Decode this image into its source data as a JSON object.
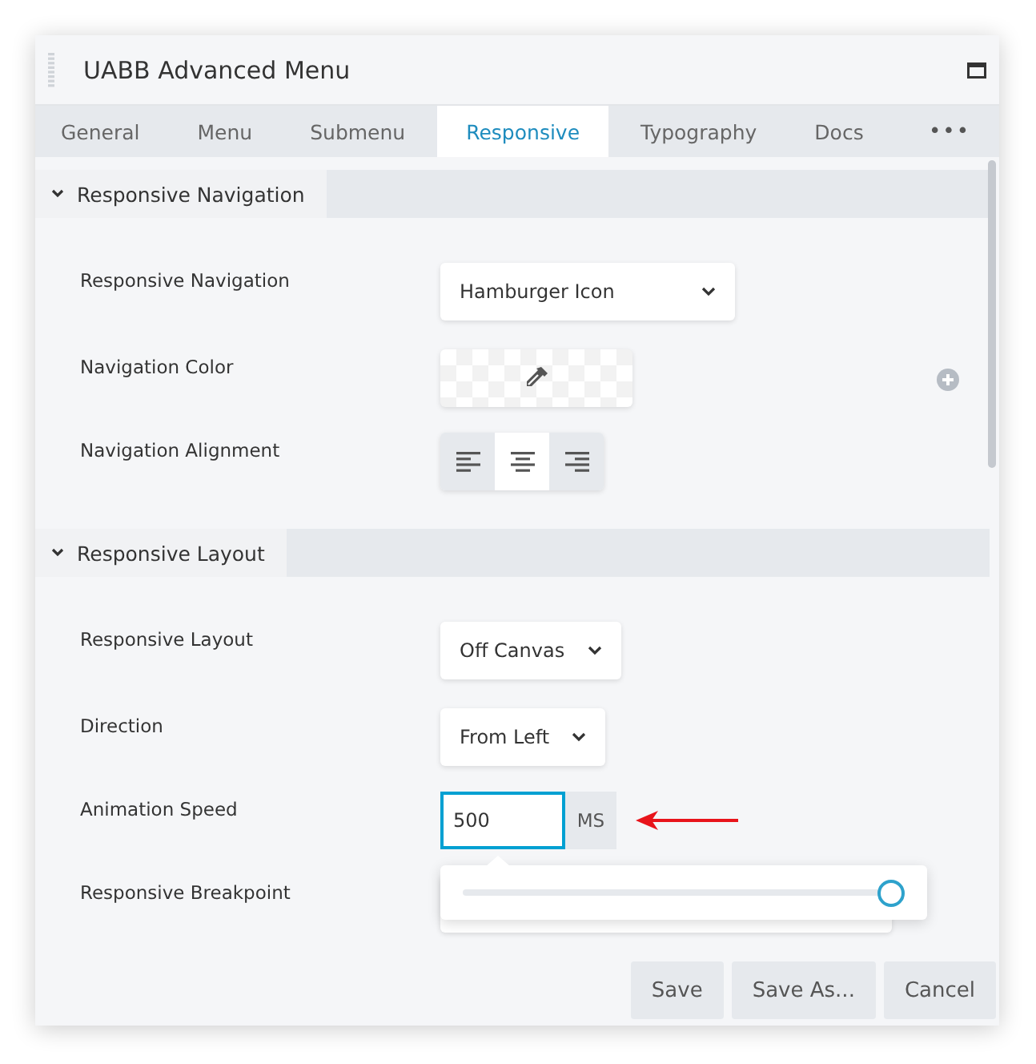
{
  "window": {
    "title": "UABB Advanced Menu"
  },
  "tabs": [
    {
      "label": "General",
      "selected": false
    },
    {
      "label": "Menu",
      "selected": false
    },
    {
      "label": "Submenu",
      "selected": false
    },
    {
      "label": "Responsive",
      "selected": true
    },
    {
      "label": "Typography",
      "selected": false
    },
    {
      "label": "Docs",
      "selected": false
    }
  ],
  "more_tabs": "•••",
  "sections": [
    {
      "title": "Responsive Navigation",
      "expanded": true,
      "fields": [
        {
          "kind": "select",
          "label": "Responsive Navigation",
          "value": "Hamburger Icon"
        },
        {
          "kind": "color",
          "label": "Navigation Color"
        },
        {
          "kind": "align",
          "label": "Navigation Alignment",
          "options": [
            {
              "kind": "left",
              "selected": false
            },
            {
              "kind": "center",
              "selected": true
            },
            {
              "kind": "right",
              "selected": false
            }
          ]
        }
      ]
    },
    {
      "title": "Responsive Layout",
      "expanded": true,
      "fields": [
        {
          "kind": "select",
          "label": "Responsive Layout",
          "value": "Off Canvas"
        },
        {
          "kind": "select",
          "label": "Direction",
          "value": "From Left"
        },
        {
          "kind": "number",
          "label": "Animation Speed",
          "value": "500",
          "unit": "MS",
          "focused": true,
          "slider": {
            "level": 1.0
          }
        },
        {
          "kind": "hidden",
          "label": "Responsive Breakpoint"
        }
      ]
    }
  ],
  "buttons": [
    "Save",
    "Save As...",
    "Cancel"
  ]
}
